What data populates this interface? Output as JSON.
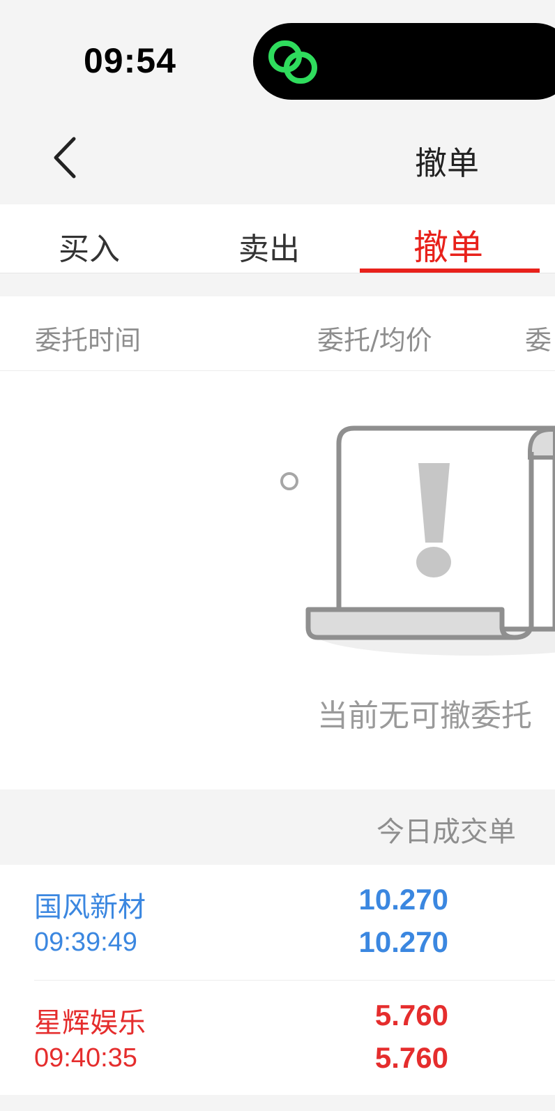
{
  "status_bar": {
    "time": "09:54"
  },
  "nav": {
    "title": "撤单"
  },
  "tabs": [
    {
      "label": "买入",
      "active": false
    },
    {
      "label": "卖出",
      "active": false
    },
    {
      "label": "撤单",
      "active": true
    }
  ],
  "table_header": {
    "columns": [
      "委托时间",
      "委托/均价",
      "委"
    ]
  },
  "empty_state": {
    "message": "当前无可撤委托"
  },
  "section": {
    "title": "今日成交单"
  },
  "trades": [
    {
      "name": "国风新材",
      "time": "09:39:49",
      "price": "10.270",
      "avg_price": "10.270",
      "color": "#3b87e0"
    },
    {
      "name": "星辉娱乐",
      "time": "09:40:35",
      "price": "5.760",
      "avg_price": "5.760",
      "color": "#e52d2d"
    }
  ],
  "colors": {
    "accent": "#e8211b",
    "buy_blue": "#3b87e0",
    "sell_red": "#e52d2d",
    "island_icon": "#2fdc5d"
  }
}
